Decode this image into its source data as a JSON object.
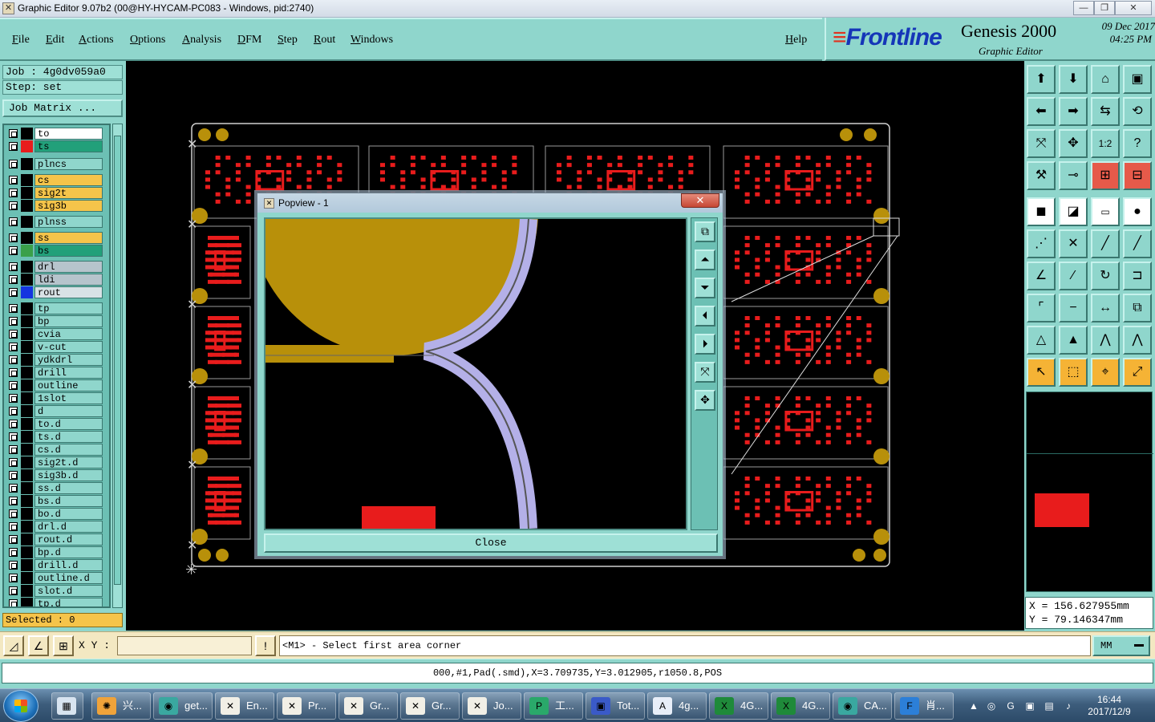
{
  "window": {
    "title": "Graphic Editor 9.07b2 (00@HY-HYCAM-PC083 - Windows, pid:2740)",
    "min_icon": "minimize-icon",
    "max_icon": "maximize-icon",
    "close_glyph": "✕"
  },
  "menu": {
    "items": [
      "File",
      "Edit",
      "Actions",
      "Options",
      "Analysis",
      "DFM",
      "Step",
      "Rout",
      "Windows"
    ],
    "help": "Help"
  },
  "brand": {
    "logo": "Frontline",
    "product": "Genesis 2000",
    "subtitle": "Graphic Editor",
    "date": "09 Dec 2017",
    "time": "04:25 PM"
  },
  "left": {
    "job": "Job : 4g0dv059a0",
    "step": "Step: set",
    "job_matrix": "Job Matrix ...",
    "layers": [
      {
        "name": "to",
        "color": "#ffffff",
        "swatch": "#000000"
      },
      {
        "name": "ts",
        "color": "#22a07a",
        "swatch": "#e81c1c",
        "active": true
      },
      {
        "name": "plncs",
        "color": "#8fd6cc",
        "swatch": "#000000"
      },
      {
        "name": "cs",
        "color": "#f5c44a",
        "swatch": "#000000"
      },
      {
        "name": "sig2t",
        "color": "#f5c44a",
        "swatch": "#000000"
      },
      {
        "name": "sig3b",
        "color": "#f5c44a",
        "swatch": "#000000"
      },
      {
        "name": "plnss",
        "color": "#8fd6cc",
        "swatch": "#000000"
      },
      {
        "name": "ss",
        "color": "#f5c44a",
        "swatch": "#000000"
      },
      {
        "name": "bs",
        "color": "#22a07a",
        "swatch": "#3aa04a"
      },
      {
        "name": "drl",
        "color": "#b6c4cc",
        "swatch": "#000000"
      },
      {
        "name": "ldi",
        "color": "#b6c4cc",
        "swatch": "#000000"
      },
      {
        "name": "rout",
        "color": "#d8e2e6",
        "swatch": "#1535e0"
      },
      {
        "name": "tp",
        "color": "#8fd6cc",
        "swatch": "#000000"
      },
      {
        "name": "bp",
        "color": "#8fd6cc",
        "swatch": "#000000"
      },
      {
        "name": "cvia",
        "color": "#8fd6cc",
        "swatch": "#000000"
      },
      {
        "name": "v-cut",
        "color": "#8fd6cc",
        "swatch": "#000000"
      },
      {
        "name": "ydkdrl",
        "color": "#8fd6cc",
        "swatch": "#000000"
      },
      {
        "name": "drill",
        "color": "#8fd6cc",
        "swatch": "#000000"
      },
      {
        "name": "outline",
        "color": "#8fd6cc",
        "swatch": "#000000"
      },
      {
        "name": "1slot",
        "color": "#8fd6cc",
        "swatch": "#000000"
      },
      {
        "name": "d",
        "color": "#8fd6cc",
        "swatch": "#000000"
      },
      {
        "name": "to.d",
        "color": "#8fd6cc",
        "swatch": "#000000"
      },
      {
        "name": "ts.d",
        "color": "#8fd6cc",
        "swatch": "#000000"
      },
      {
        "name": "cs.d",
        "color": "#8fd6cc",
        "swatch": "#000000"
      },
      {
        "name": "sig2t.d",
        "color": "#8fd6cc",
        "swatch": "#000000"
      },
      {
        "name": "sig3b.d",
        "color": "#8fd6cc",
        "swatch": "#000000"
      },
      {
        "name": "ss.d",
        "color": "#8fd6cc",
        "swatch": "#000000"
      },
      {
        "name": "bs.d",
        "color": "#8fd6cc",
        "swatch": "#000000"
      },
      {
        "name": "bo.d",
        "color": "#8fd6cc",
        "swatch": "#000000"
      },
      {
        "name": "drl.d",
        "color": "#8fd6cc",
        "swatch": "#000000"
      },
      {
        "name": "rout.d",
        "color": "#8fd6cc",
        "swatch": "#000000"
      },
      {
        "name": "bp.d",
        "color": "#8fd6cc",
        "swatch": "#000000"
      },
      {
        "name": "drill.d",
        "color": "#8fd6cc",
        "swatch": "#000000"
      },
      {
        "name": "outline.d",
        "color": "#8fd6cc",
        "swatch": "#000000"
      },
      {
        "name": "slot.d",
        "color": "#8fd6cc",
        "swatch": "#000000"
      },
      {
        "name": "tp.d",
        "color": "#8fd6cc",
        "swatch": "#000000"
      }
    ],
    "selected": "Selected : 0"
  },
  "popview": {
    "title": "Popview - 1",
    "close_glyph": "✕",
    "close_button": "Close",
    "tools": [
      "zoom-window-icon",
      "pan-up-icon",
      "pan-down-icon",
      "pan-left-icon",
      "pan-right-icon",
      "zoom-fit-icon",
      "zoom-home-icon"
    ],
    "colors": {
      "copper": "#b8900a",
      "rout": "#b4b0e8",
      "pad": "#e81c1c"
    }
  },
  "right": {
    "coords_x": "X = 156.627955mm",
    "coords_y": "Y = 79.146347mm"
  },
  "cmd": {
    "xy_label": "X Y :",
    "xy_value": "",
    "alert_glyph": "!",
    "prompt": "<M1> - Select first area corner",
    "units": "MM"
  },
  "status": {
    "text": "000,#1,Pad(.smd),X=3.709735,Y=3.012905,r1050.8,POS"
  },
  "taskbar": {
    "items": [
      {
        "label": "兴...",
        "icon": "shell-icon"
      },
      {
        "label": "get...",
        "icon": "eye-icon"
      },
      {
        "label": "En...",
        "icon": "x-window-icon"
      },
      {
        "label": "Pr...",
        "icon": "x-window-icon"
      },
      {
        "label": "Gr...",
        "icon": "x-window-icon"
      },
      {
        "label": "Gr...",
        "icon": "x-window-icon"
      },
      {
        "label": "Jo...",
        "icon": "x-window-icon"
      },
      {
        "label": "工...",
        "icon": "p-logo-icon"
      },
      {
        "label": "Tot...",
        "icon": "floppy-icon"
      },
      {
        "label": "4g...",
        "icon": "document-icon"
      },
      {
        "label": "4G...",
        "icon": "excel-icon"
      },
      {
        "label": "4G...",
        "icon": "excel-icon"
      },
      {
        "label": "CA...",
        "icon": "eye-icon"
      },
      {
        "label": "肖...",
        "icon": "f-logo-icon"
      }
    ],
    "time": "16:44",
    "date": "2017/12/9"
  }
}
